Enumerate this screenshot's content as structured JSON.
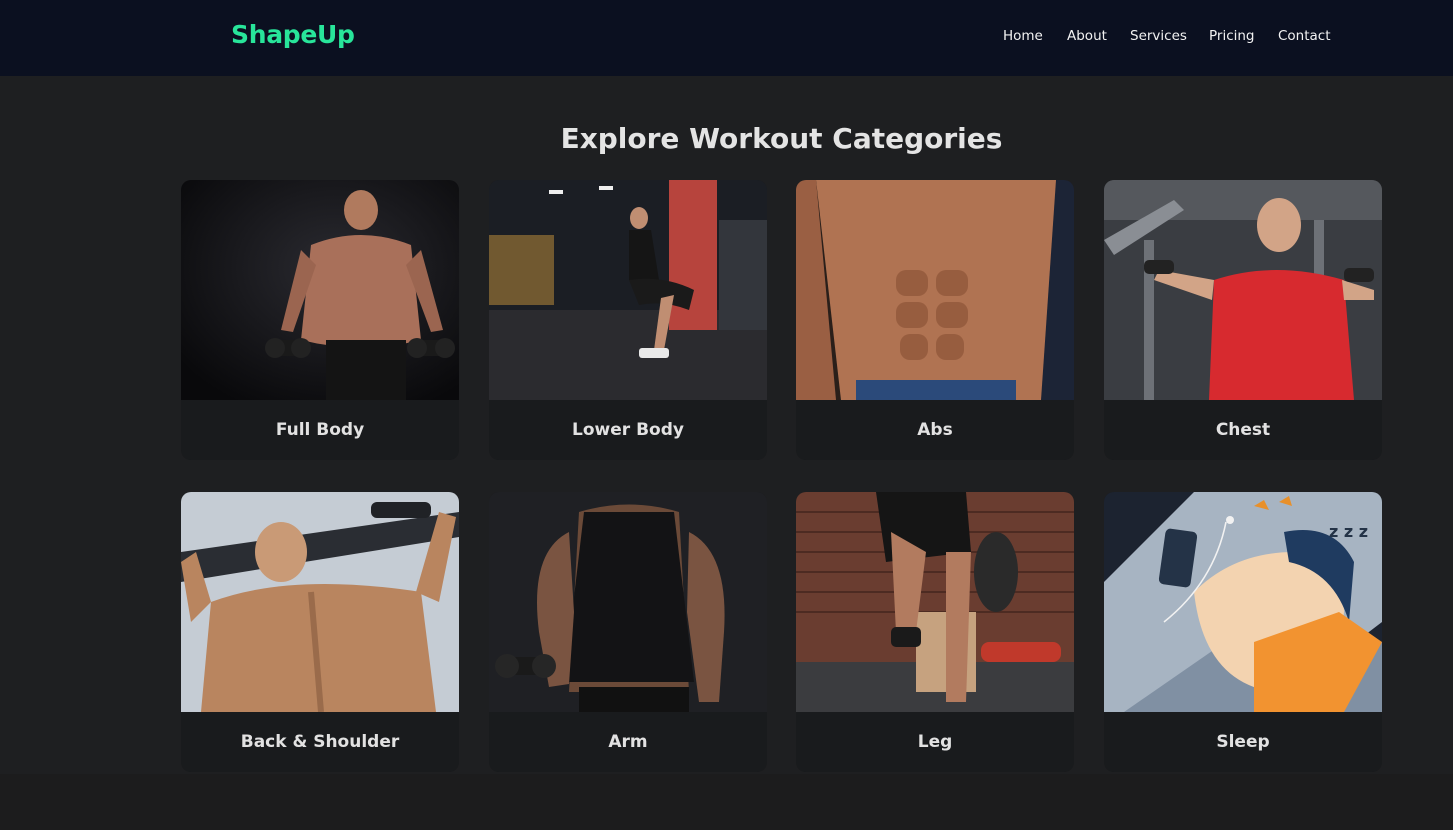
{
  "brand": {
    "name": "ShapeUp",
    "color": "#28e59a"
  },
  "nav": [
    {
      "label": "Home"
    },
    {
      "label": "About"
    },
    {
      "label": "Services"
    },
    {
      "label": "Pricing"
    },
    {
      "label": "Contact"
    }
  ],
  "section": {
    "title": "Explore Workout Categories"
  },
  "categories": [
    {
      "label": "Full Body",
      "image": "muscular-man-dumbbells-photo"
    },
    {
      "label": "Lower Body",
      "image": "woman-squat-gym-photo"
    },
    {
      "label": "Abs",
      "image": "abs-torso-photo"
    },
    {
      "label": "Chest",
      "image": "man-chest-machine-photo"
    },
    {
      "label": "Back & Shoulder",
      "image": "back-pullup-photo"
    },
    {
      "label": "Arm",
      "image": "arm-curl-photo"
    },
    {
      "label": "Leg",
      "image": "leg-step-photo"
    },
    {
      "label": "Sleep",
      "image": "sleep-illustration"
    }
  ]
}
